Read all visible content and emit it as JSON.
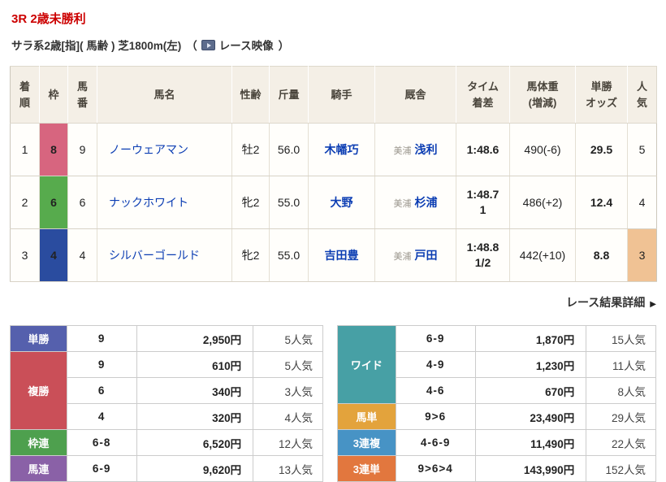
{
  "page": {
    "title": "3R 2歳未勝利"
  },
  "race_info": {
    "conditions": "サラ系2歳[指]( 馬齢 ) 芝1800m(左)",
    "paren_open": "（",
    "video_label": "レース映像",
    "paren_close": "）"
  },
  "results_table": {
    "headers": [
      "着\n順",
      "枠",
      "馬\n番",
      "馬名",
      "性齢",
      "斤量",
      "騎手",
      "厩舎",
      "タイム\n着差",
      "馬体重\n(増減)",
      "単勝\nオッズ",
      "人\n気"
    ],
    "rows": [
      {
        "pos": "1",
        "waku": "8",
        "waku_color": "#d7657f",
        "num": "9",
        "horse": "ノーウェアマン",
        "sexage": "牡2",
        "carried": "56.0",
        "jockey": "木幡巧",
        "stable_loc": "美浦",
        "trainer": "浅利",
        "time": "1:48.6",
        "margin": "",
        "hweight": "490(-6)",
        "odds": "29.5",
        "pop": "5"
      },
      {
        "pos": "2",
        "waku": "6",
        "waku_color": "#57ab4d",
        "num": "6",
        "horse": "ナックホワイト",
        "sexage": "牝2",
        "carried": "55.0",
        "jockey": "大野",
        "stable_loc": "美浦",
        "trainer": "杉浦",
        "time": "1:48.7",
        "margin": "1",
        "hweight": "486(+2)",
        "odds": "12.4",
        "pop": "4"
      },
      {
        "pos": "3",
        "waku": "4",
        "waku_color": "#2a4c9f",
        "num": "4",
        "horse": "シルバーゴールド",
        "sexage": "牝2",
        "carried": "55.0",
        "jockey": "吉田豊",
        "stable_loc": "美浦",
        "trainer": "戸田",
        "time": "1:48.8",
        "margin": "1/2",
        "hweight": "442(+10)",
        "odds": "8.8",
        "pop": "3"
      }
    ]
  },
  "results_link": {
    "label": "レース結果詳細",
    "arrow": "▶"
  },
  "payouts": {
    "left": [
      {
        "label": "単勝",
        "color": "#5560ad",
        "rows": [
          {
            "combo": "9",
            "amount": "2,950円",
            "pop": "5人気"
          }
        ]
      },
      {
        "label": "複勝",
        "color": "#ca4f58",
        "rows": [
          {
            "combo": "9",
            "amount": "610円",
            "pop": "5人気"
          },
          {
            "combo": "6",
            "amount": "340円",
            "pop": "3人気"
          },
          {
            "combo": "4",
            "amount": "320円",
            "pop": "4人気"
          }
        ]
      },
      {
        "label": "枠連",
        "color": "#4ea04e",
        "rows": [
          {
            "combo": "6-8",
            "amount": "6,520円",
            "pop": "12人気"
          }
        ]
      },
      {
        "label": "馬連",
        "color": "#8a61a7",
        "rows": [
          {
            "combo": "6-9",
            "amount": "9,620円",
            "pop": "13人気"
          }
        ]
      }
    ],
    "right": [
      {
        "label": "ワイド",
        "color": "#47a0a5",
        "rows": [
          {
            "combo": "6-9",
            "amount": "1,870円",
            "pop": "15人気"
          },
          {
            "combo": "4-9",
            "amount": "1,230円",
            "pop": "11人気"
          },
          {
            "combo": "4-6",
            "amount": "670円",
            "pop": "8人気"
          }
        ]
      },
      {
        "label": "馬単",
        "color": "#e3a33c",
        "rows": [
          {
            "combo": "9>6",
            "amount": "23,490円",
            "pop": "29人気"
          }
        ]
      },
      {
        "label": "3連複",
        "color": "#4793c5",
        "rows": [
          {
            "combo": "4-6-9",
            "amount": "11,490円",
            "pop": "22人気"
          }
        ]
      },
      {
        "label": "3連単",
        "color": "#e2773e",
        "rows": [
          {
            "combo": "9>6>4",
            "amount": "143,990円",
            "pop": "152人気"
          }
        ]
      }
    ]
  },
  "colors": {
    "pop_highlight": "#f0c294",
    "title_red": "#cc0000",
    "link_blue": "#0b3db3"
  }
}
